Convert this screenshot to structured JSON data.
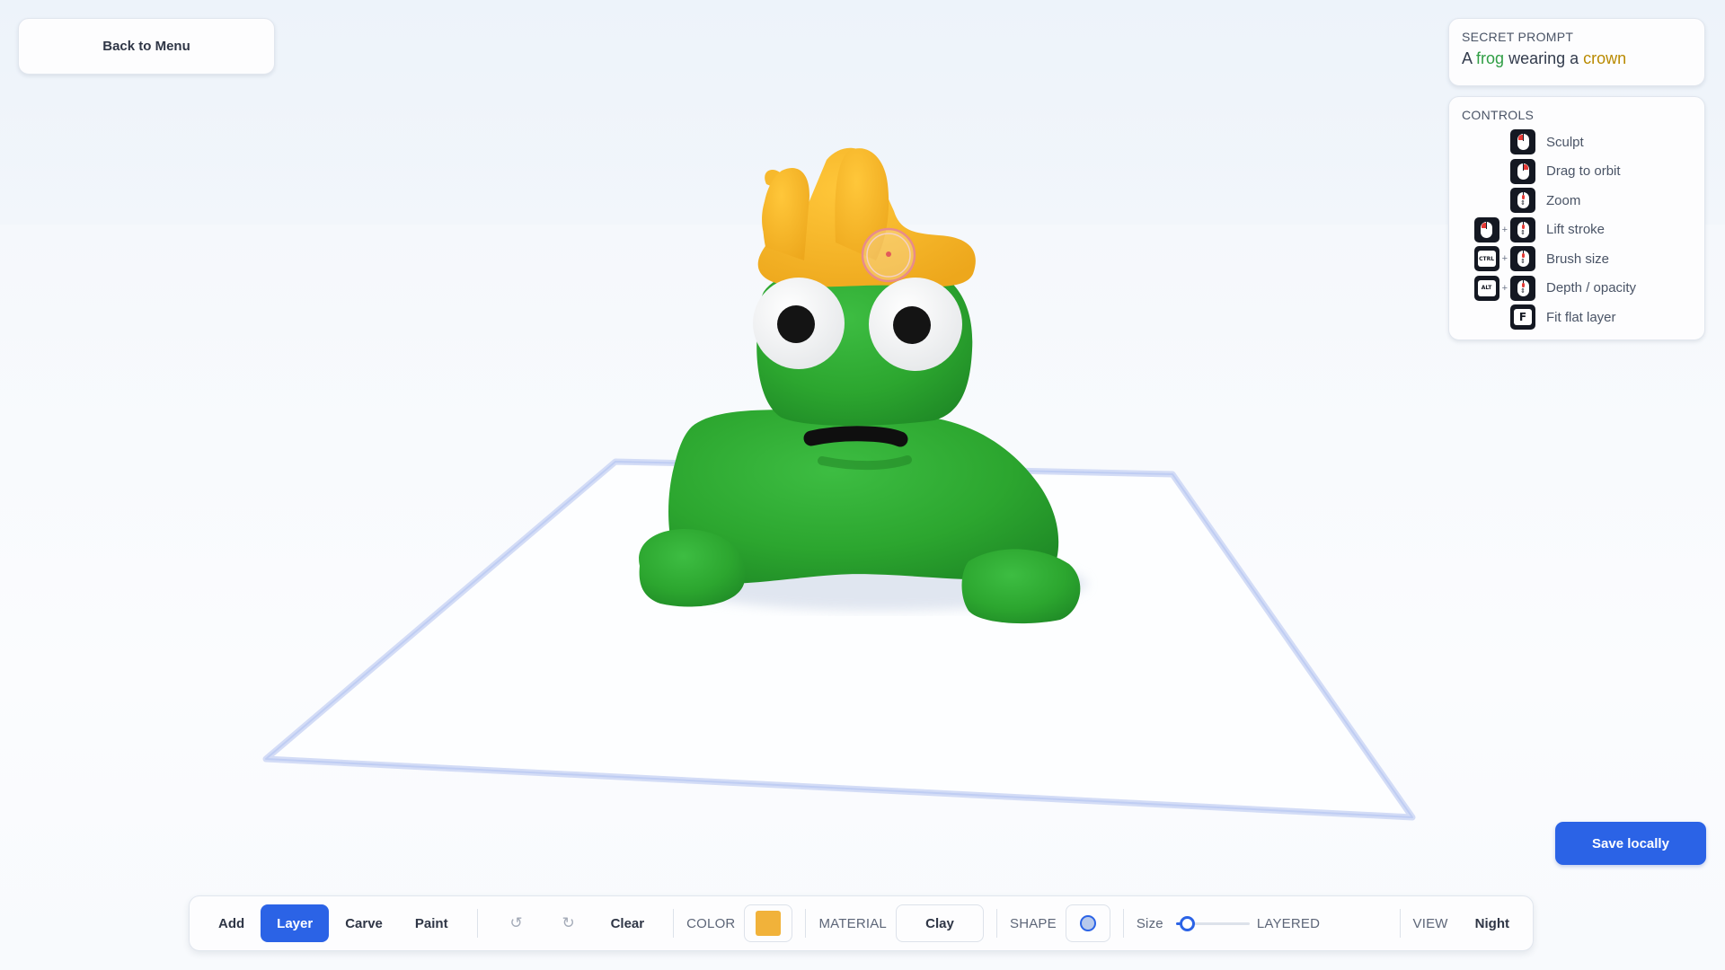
{
  "back_button": {
    "label": "Back to Menu"
  },
  "prompt": {
    "label": "SECRET PROMPT",
    "words": [
      "A",
      "frog",
      "wearing a",
      "crown"
    ],
    "highlight_colors": {
      "frog": "#2f9e44",
      "crown": "#b98a00"
    }
  },
  "controls": {
    "title": "CONTROLS",
    "items": [
      {
        "keys": [
          "mouse-left-click"
        ],
        "label": "Sculpt"
      },
      {
        "keys": [
          "mouse-right-drag"
        ],
        "label": "Drag to orbit"
      },
      {
        "keys": [
          "mouse-scroll"
        ],
        "label": "Zoom"
      },
      {
        "keys": [
          "mouse-left-click",
          "mouse-scroll"
        ],
        "label": "Lift stroke"
      },
      {
        "keys": [
          "CTRL",
          "mouse-scroll"
        ],
        "label": "Brush size"
      },
      {
        "keys": [
          "ALT",
          "mouse-scroll"
        ],
        "label": "Depth / opacity"
      },
      {
        "keys": [
          "F"
        ],
        "label": "Fit flat layer"
      }
    ]
  },
  "save_button": {
    "label": "Save locally"
  },
  "toolbar": {
    "modes": [
      "Add",
      "Layer",
      "Carve",
      "Paint"
    ],
    "active_mode": "Layer",
    "undo_icon": "undo-icon",
    "redo_icon": "redo-icon",
    "clear_label": "Clear",
    "color_label": "COLOR",
    "color_value": "#f1b23a",
    "material_label": "MATERIAL",
    "material_value": "Clay",
    "shape_label": "SHAPE",
    "shape_icon": "sphere-shape-icon",
    "size_label": "Size",
    "size_value": 0.15,
    "layered_label": "LAYERED",
    "view_label": "VIEW",
    "view_value": "Night"
  },
  "scene": {
    "accent_color": "#2b63e6",
    "sculpture_colors": {
      "frog": "#2ca62f",
      "crown": "#f7b526",
      "eye": "#ffffff",
      "pupil": "#141414"
    }
  }
}
